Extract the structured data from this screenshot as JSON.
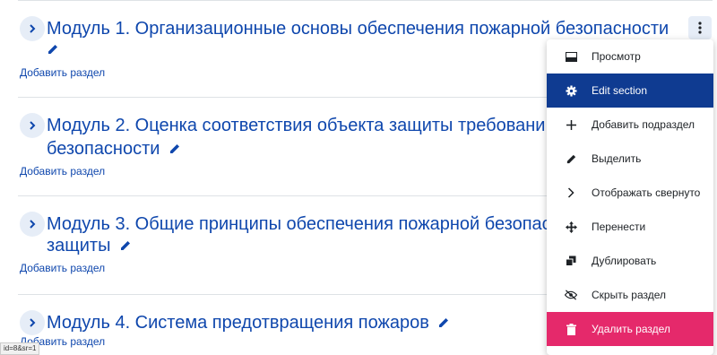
{
  "sections": [
    {
      "title_line1": "Модуль 1. Организационные основы обеспечения пожарной безопасности",
      "title_line2": "",
      "add_label": "Добавить раздел"
    },
    {
      "title_line1": "Модуль 2. Оценка соответствия объекта защиты требовани",
      "title_line2": "безопасности",
      "add_label": "Добавить раздел"
    },
    {
      "title_line1": "Модуль 3. Общие принципы обеспечения пожарной безопас",
      "title_line2": "защиты",
      "add_label": "Добавить раздел"
    },
    {
      "title_line1": "Модуль 4. Система предотвращения пожаров",
      "title_line2": "",
      "add_label": "Добавить раздел"
    }
  ],
  "menu": {
    "items": [
      {
        "label": "Просмотр",
        "icon": "preview-icon"
      },
      {
        "label": "Edit section",
        "icon": "gear-icon"
      },
      {
        "label": "Добавить подраздел",
        "icon": "plus-icon"
      },
      {
        "label": "Выделить",
        "icon": "pencil-icon"
      },
      {
        "label": "Отображать свернуто",
        "icon": "chevron-right-icon"
      },
      {
        "label": "Перенести",
        "icon": "move-icon"
      },
      {
        "label": "Дублировать",
        "icon": "copy-icon"
      },
      {
        "label": "Скрыть раздел",
        "icon": "eye-slash-icon"
      },
      {
        "label": "Удалить раздел",
        "icon": "trash-icon"
      }
    ]
  },
  "status_bar": {
    "text": "id=8&sr=1"
  },
  "colors": {
    "link": "#0f47ad",
    "active": "#0f3b91",
    "danger": "#e5296b"
  }
}
